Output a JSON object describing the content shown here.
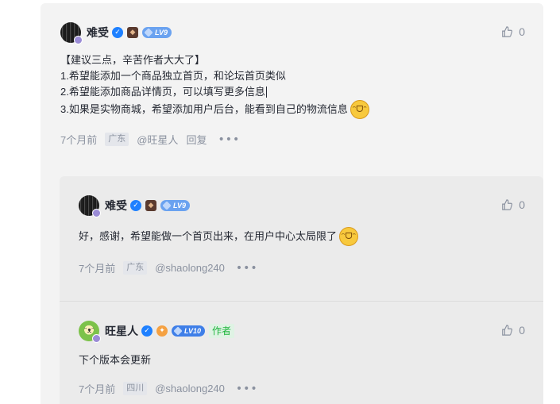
{
  "main_comment": {
    "username": "难受",
    "level": "LV9",
    "likes": "0",
    "lines": [
      "【建议三点，辛苦作者大大了】",
      "1.希望能添加一个商品独立首页，和论坛首页类似",
      "2.希望能添加商品详情页，可以填写更多信息",
      "3.如果是实物商城，希望添加用户后台，能看到自己的物流信息"
    ],
    "time": "7个月前",
    "region": "广东",
    "mention": "@旺星人",
    "reply_label": "回复"
  },
  "replies": [
    {
      "username": "难受",
      "level": "LV9",
      "likes": "0",
      "text": "好，感谢，希望能做一个首页出来，在用户中心太局限了",
      "time": "7个月前",
      "region": "广东",
      "mention": "@shaolong240"
    },
    {
      "username": "旺星人",
      "level": "LV10",
      "author_tag": "作者",
      "likes": "0",
      "text": "下个版本会更新",
      "time": "7个月前",
      "region": "四川",
      "mention": "@shaolong240"
    }
  ],
  "colors": {
    "verified": "#1e80ff",
    "level_badge": "#6aa2f0",
    "author_tag": "#1eb53c"
  }
}
